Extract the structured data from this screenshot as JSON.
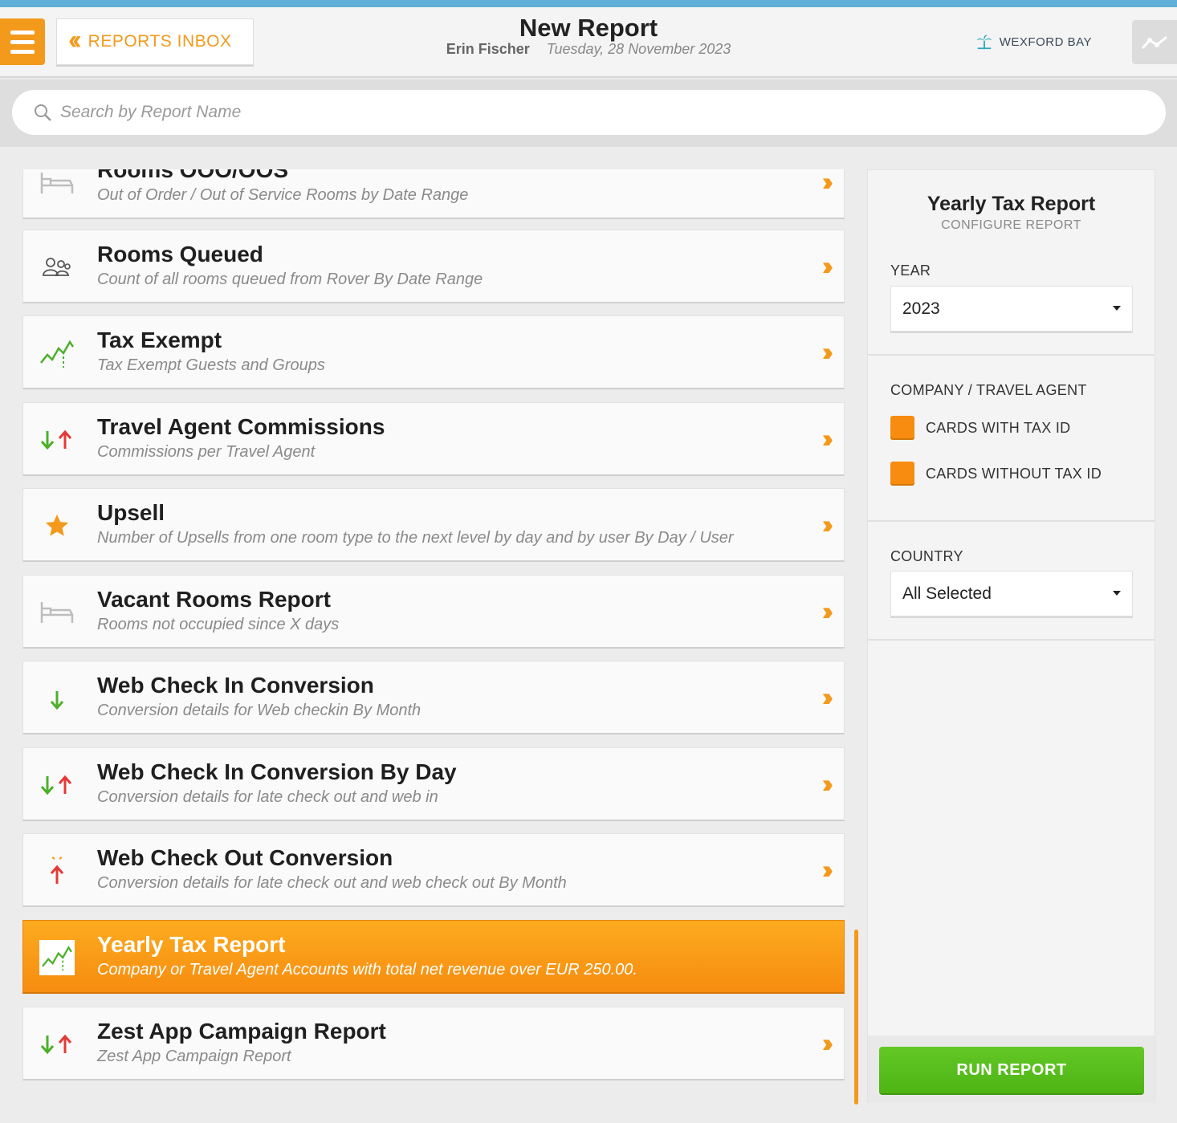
{
  "header": {
    "inbox_label": "REPORTS INBOX",
    "title": "New Report",
    "user": "Erin Fischer",
    "date": "Tuesday, 28 November 2023",
    "hotel_name": "WEXFORD BAY"
  },
  "search": {
    "placeholder": "Search by Report Name"
  },
  "reports": [
    {
      "title": "Rooms OOO/OOS",
      "desc": "Out of Order / Out of Service Rooms by Date Range",
      "icon": "bed-icon"
    },
    {
      "title": "Rooms Queued",
      "desc": "Count of all rooms queued from Rover By Date Range",
      "icon": "people-icon"
    },
    {
      "title": "Tax Exempt",
      "desc": "Tax Exempt Guests and Groups",
      "icon": "trend-chart-icon"
    },
    {
      "title": "Travel Agent Commissions",
      "desc": "Commissions per Travel Agent",
      "icon": "up-down-arrows-icon"
    },
    {
      "title": "Upsell",
      "desc": "Number of Upsells from one room type to the next level by day and by user By Day / User",
      "icon": "star-icon"
    },
    {
      "title": "Vacant Rooms Report",
      "desc": "Rooms not occupied since X days",
      "icon": "bed-icon"
    },
    {
      "title": "Web Check In Conversion",
      "desc": "Conversion details for Web checkin By Month",
      "icon": "arrow-down-icon"
    },
    {
      "title": "Web Check In Conversion By Day",
      "desc": "Conversion details for late check out and web in",
      "icon": "up-down-arrows-icon"
    },
    {
      "title": "Web Check Out Conversion",
      "desc": "Conversion details for late check out and web check out By Month",
      "icon": "arrow-up-icon"
    },
    {
      "title": "Yearly Tax Report",
      "desc": "Company or Travel Agent Accounts with total net revenue over EUR 250.00.",
      "icon": "trend-chart-icon"
    },
    {
      "title": "Zest App Campaign Report",
      "desc": "Zest App Campaign Report",
      "icon": "up-down-arrows-icon"
    }
  ],
  "panel": {
    "title": "Yearly Tax Report",
    "subtitle": "CONFIGURE REPORT",
    "year_label": "YEAR",
    "year_value": "2023",
    "company_label": "COMPANY / TRAVEL AGENT",
    "check1": "CARDS WITH TAX ID",
    "check2": "CARDS WITHOUT TAX ID",
    "country_label": "COUNTRY",
    "country_value": "All Selected",
    "run_label": "RUN REPORT"
  },
  "colors": {
    "accent": "#f39a1c",
    "run": "#55b81a",
    "topbar": "#5fb0d6"
  }
}
